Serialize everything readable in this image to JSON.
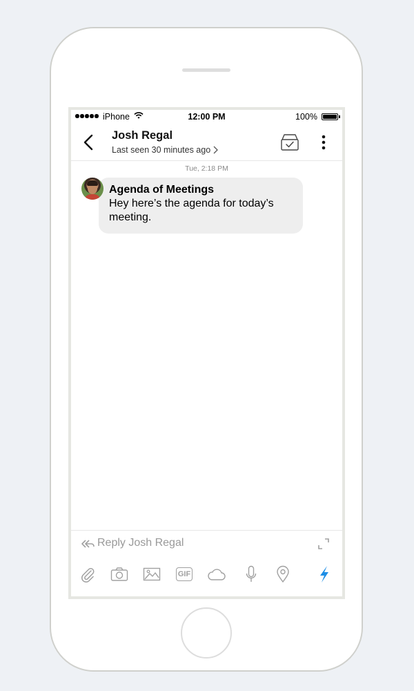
{
  "status_bar": {
    "carrier": "iPhone",
    "time": "12:00 PM",
    "battery": "100%"
  },
  "header": {
    "contact_name": "Josh Regal",
    "last_seen": "Last seen 30 minutes ago"
  },
  "conversation": {
    "timestamp": "Tue, 2:18 PM",
    "messages": [
      {
        "title": "Agenda of Meetings",
        "text": "Hey here’s the agenda for today’s meeting."
      }
    ]
  },
  "composer": {
    "placeholder": "Reply Josh Regal",
    "toolbar": [
      {
        "icon": "paperclip-icon"
      },
      {
        "icon": "camera-icon"
      },
      {
        "icon": "image-icon"
      },
      {
        "icon": "gif-icon",
        "label": "GIF"
      },
      {
        "icon": "cloud-icon"
      },
      {
        "icon": "microphone-icon"
      },
      {
        "icon": "location-pin-icon"
      },
      {
        "icon": "lightning-icon"
      }
    ]
  },
  "colors": {
    "background": "#eef1f5",
    "bubble": "#eeeeee",
    "accent": "#1e8ee6",
    "icon_gray": "#a0a0a0"
  }
}
